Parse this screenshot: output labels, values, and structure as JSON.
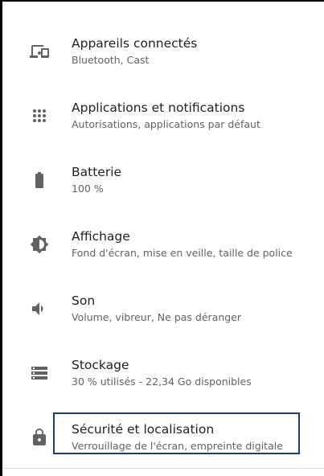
{
  "settings": {
    "items": [
      {
        "title": "Appareils connectés",
        "subtitle": "Bluetooth, Cast",
        "icon": "connected-devices-icon"
      },
      {
        "title": "Applications et notifications",
        "subtitle": "Autorisations, applications par défaut",
        "icon": "apps-grid-icon"
      },
      {
        "title": "Batterie",
        "subtitle": "100 %",
        "icon": "battery-icon"
      },
      {
        "title": "Affichage",
        "subtitle": "Fond d'écran, mise en veille, taille de police",
        "icon": "brightness-icon"
      },
      {
        "title": "Son",
        "subtitle": "Volume, vibreur, Ne pas déranger",
        "icon": "volume-icon"
      },
      {
        "title": "Stockage",
        "subtitle": "30 % utilisés - 22,34 Go disponibles",
        "icon": "storage-icon"
      },
      {
        "title": "Sécurité et localisation",
        "subtitle": "Verrouillage de l'écran, empreinte digitale",
        "icon": "lock-icon"
      }
    ]
  },
  "colors": {
    "icon": "#5f6368",
    "title": "#202124",
    "subtitle": "#5f6368",
    "focus_border": "#1a3f6b"
  }
}
